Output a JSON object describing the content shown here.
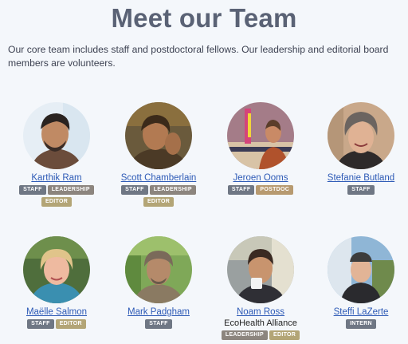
{
  "header": {
    "title": "Meet our Team",
    "intro": "Our core team includes staff and postdoctoral fellows. Our leadership and editorial board members are volunteers."
  },
  "colors": {
    "name": "#2d5ab6",
    "title": "#5a6275",
    "staff": "#6f7784",
    "leadership": "#8c857e",
    "editor": "#b3a576",
    "postdoc": "#b79a70",
    "intern": "#6f7784"
  },
  "members": [
    {
      "name": "Karthik Ram",
      "photo_icon": "avatar-photo-icon",
      "badges": [
        {
          "label": "STAFF",
          "color": "#6f7784"
        },
        {
          "label": "LEADERSHIP",
          "color": "#8c857e"
        },
        {
          "label": "EDITOR",
          "color": "#b3a576"
        }
      ]
    },
    {
      "name": "Scott Chamberlain",
      "photo_icon": "avatar-photo-icon",
      "badges": [
        {
          "label": "STAFF",
          "color": "#6f7784"
        },
        {
          "label": "LEADERSHIP",
          "color": "#8c857e"
        },
        {
          "label": "EDITOR",
          "color": "#b3a576"
        }
      ]
    },
    {
      "name": "Jeroen Ooms",
      "photo_icon": "avatar-photo-icon",
      "badges": [
        {
          "label": "STAFF",
          "color": "#6f7784"
        },
        {
          "label": "POSTDOC",
          "color": "#b79a70"
        }
      ]
    },
    {
      "name": "Stefanie Butland",
      "photo_icon": "avatar-photo-icon",
      "badges": [
        {
          "label": "STAFF",
          "color": "#6f7784"
        }
      ]
    },
    {
      "name": "Maëlle Salmon",
      "photo_icon": "avatar-photo-icon",
      "badges": [
        {
          "label": "STAFF",
          "color": "#6f7784"
        },
        {
          "label": "EDITOR",
          "color": "#b3a576"
        }
      ]
    },
    {
      "name": "Mark Padgham",
      "photo_icon": "avatar-photo-icon",
      "badges": [
        {
          "label": "STAFF",
          "color": "#6f7784"
        }
      ]
    },
    {
      "name": "Noam Ross",
      "affiliation": "EcoHealth Alliance",
      "photo_icon": "avatar-photo-icon",
      "badges": [
        {
          "label": "LEADERSHIP",
          "color": "#8c857e"
        },
        {
          "label": "EDITOR",
          "color": "#b3a576"
        }
      ]
    },
    {
      "name": "Steffi LaZerte",
      "photo_icon": "avatar-photo-icon",
      "badges": [
        {
          "label": "INTERN",
          "color": "#6f7784"
        }
      ]
    }
  ]
}
